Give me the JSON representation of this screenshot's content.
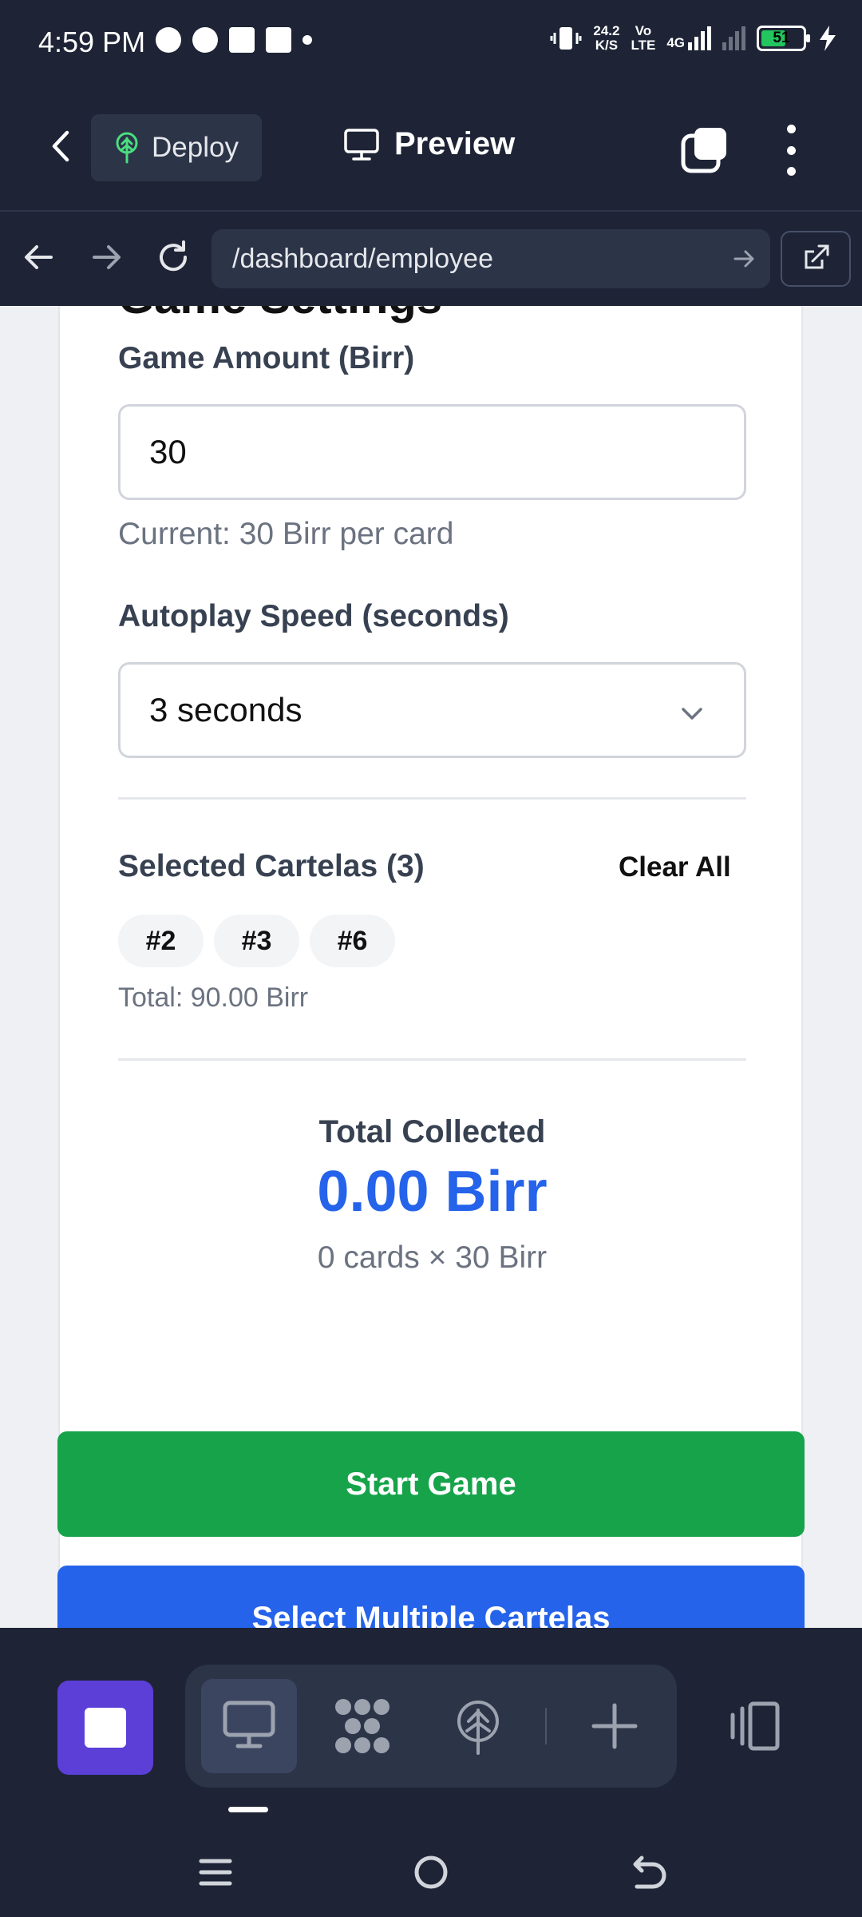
{
  "status_bar": {
    "time": "4:59 PM",
    "net_speed_top": "24.2",
    "net_speed_bottom": "K/S",
    "volte_top": "Vo",
    "volte_bottom": "LTE",
    "network_type": "4G",
    "battery": "51"
  },
  "app_bar": {
    "deploy_label": "Deploy",
    "preview_label": "Preview"
  },
  "url_bar": {
    "url": "/dashboard/employee"
  },
  "settings": {
    "title": "Game Settings",
    "amount_label": "Game Amount (Birr)",
    "amount_value": "30",
    "amount_hint": "Current: 30 Birr per card",
    "speed_label": "Autoplay Speed (seconds)",
    "speed_value": "3 seconds",
    "selected_label": "Selected Cartelas (3)",
    "clear_all": "Clear All",
    "chips": [
      "#2",
      "#3",
      "#6"
    ],
    "selected_total": "Total: 90.00 Birr",
    "collected_label": "Total Collected",
    "collected_value": "0.00 Birr",
    "collected_detail": "0 cards × 30 Birr"
  },
  "actions": {
    "start_game": "Start Game",
    "select_multiple": "Select Multiple Cartelas"
  },
  "colors": {
    "bar_bg": "#1e2436",
    "accent_blue": "#2563eb",
    "accent_green": "#16a34a",
    "stop_purple": "#5b3fd6"
  },
  "icons": [
    "chevron-left-icon",
    "deploy-tree-icon",
    "monitor-icon",
    "tabs-icon",
    "more-vertical-icon",
    "arrow-left-icon",
    "arrow-right-icon",
    "reload-icon",
    "external-link-icon",
    "chevron-down-icon",
    "stop-icon",
    "apps-grid-icon",
    "globe-icon",
    "plus-icon",
    "device-toggle-icon",
    "menu-icon",
    "home-icon",
    "back-icon"
  ]
}
